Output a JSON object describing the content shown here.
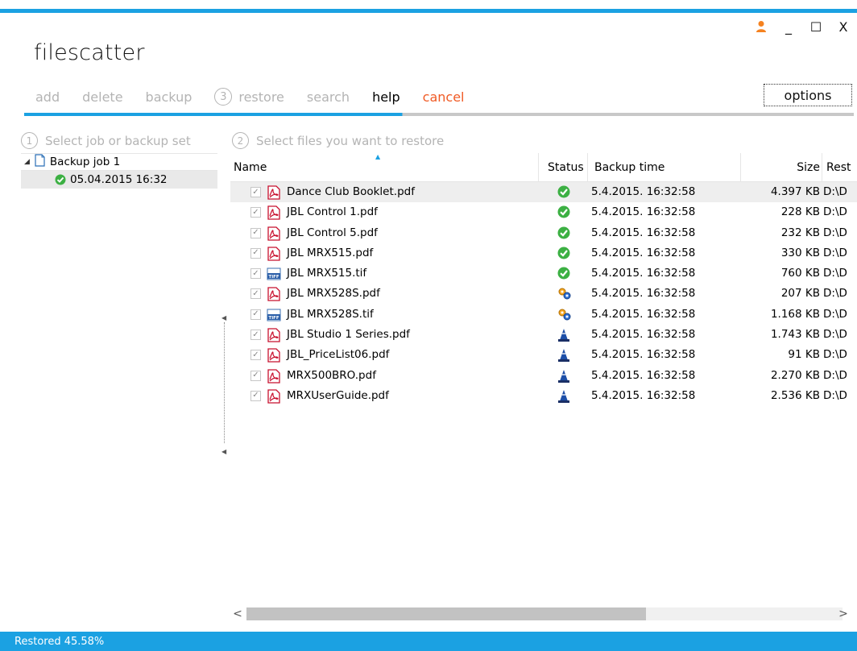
{
  "app": {
    "title": "filescatter"
  },
  "window": {
    "user_icon": "user-icon",
    "minimize": "_",
    "maximize": "☐",
    "close": "X"
  },
  "menu": {
    "add": "add",
    "delete": "delete",
    "backup": "backup",
    "restore_num": "3",
    "restore": "restore",
    "search": "search",
    "help": "help",
    "cancel": "cancel",
    "options": "options"
  },
  "steps": {
    "step1_num": "1",
    "step1": "Select job or backup set",
    "step2_num": "2",
    "step2": "Select files you want to restore"
  },
  "tree": {
    "job": "Backup job 1",
    "set": "05.04.2015 16:32"
  },
  "grid": {
    "headers": {
      "name": "Name",
      "status": "Status",
      "backup_time": "Backup time",
      "size": "Size",
      "rest": "Rest"
    },
    "rows": [
      {
        "name": "Dance Club Booklet.pdf",
        "type": "pdf",
        "status": "ok",
        "time": "5.4.2015. 16:32:58",
        "size": "4.397 KB",
        "rest": "D:\\D"
      },
      {
        "name": "JBL Control 1.pdf",
        "type": "pdf",
        "status": "ok",
        "time": "5.4.2015. 16:32:58",
        "size": "228 KB",
        "rest": "D:\\D"
      },
      {
        "name": "JBL Control 5.pdf",
        "type": "pdf",
        "status": "ok",
        "time": "5.4.2015. 16:32:58",
        "size": "232 KB",
        "rest": "D:\\D"
      },
      {
        "name": "JBL MRX515.pdf",
        "type": "pdf",
        "status": "ok",
        "time": "5.4.2015. 16:32:58",
        "size": "330 KB",
        "rest": "D:\\D"
      },
      {
        "name": "JBL MRX515.tif",
        "type": "tif",
        "status": "ok",
        "time": "5.4.2015. 16:32:58",
        "size": "760 KB",
        "rest": "D:\\D"
      },
      {
        "name": "JBL MRX528S.pdf",
        "type": "pdf",
        "status": "processing",
        "time": "5.4.2015. 16:32:58",
        "size": "207 KB",
        "rest": "D:\\D"
      },
      {
        "name": "JBL MRX528S.tif",
        "type": "tif",
        "status": "processing",
        "time": "5.4.2015. 16:32:58",
        "size": "1.168 KB",
        "rest": "D:\\D"
      },
      {
        "name": "JBL Studio 1 Series.pdf",
        "type": "pdf",
        "status": "pending",
        "time": "5.4.2015. 16:32:58",
        "size": "1.743 KB",
        "rest": "D:\\D"
      },
      {
        "name": "JBL_PriceList06.pdf",
        "type": "pdf",
        "status": "pending",
        "time": "5.4.2015. 16:32:58",
        "size": "91 KB",
        "rest": "D:\\D"
      },
      {
        "name": "MRX500BRO.pdf",
        "type": "pdf",
        "status": "pending",
        "time": "5.4.2015. 16:32:58",
        "size": "2.270 KB",
        "rest": "D:\\D"
      },
      {
        "name": "MRXUserGuide.pdf",
        "type": "pdf",
        "status": "pending",
        "time": "5.4.2015. 16:32:58",
        "size": "2.536 KB",
        "rest": "D:\\D"
      }
    ]
  },
  "scroll": {
    "left": "<",
    "right": ">"
  },
  "statusbar": {
    "text": "Restored 45.58%",
    "progress": 0.4558
  },
  "colors": {
    "accent": "#1ba1e2",
    "cancel": "#f05a24",
    "ok": "#3cb043",
    "muted": "#b4b4b4"
  }
}
